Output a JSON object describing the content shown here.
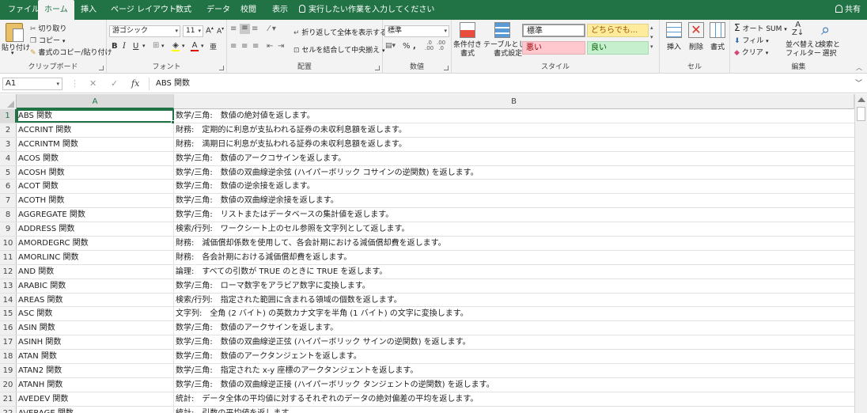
{
  "tabs": [
    "ファイル",
    "ホーム",
    "挿入",
    "ページ レイアウト",
    "数式",
    "データ",
    "校閲",
    "表示"
  ],
  "tell_me": "実行したい作業を入力してください",
  "share": "共有",
  "ribbon": {
    "clipboard": {
      "paste": "貼り付け",
      "cut": "切り取り",
      "copy": "コピー",
      "format_painter": "書式のコピー/貼り付け",
      "label": "クリップボード"
    },
    "font": {
      "name": "游ゴシック",
      "size": "11",
      "label": "フォント"
    },
    "alignment": {
      "wrap": "折り返して全体を表示する",
      "merge": "セルを結合して中央揃え",
      "label": "配置"
    },
    "number": {
      "format": "標準",
      "label": "数値"
    },
    "styles": {
      "conditional": "条件付き\n書式",
      "table": "テーブルとして\n書式設定",
      "normal": "標準",
      "neutral": "どちらでも...",
      "bad": "悪い",
      "good": "良い",
      "label": "スタイル"
    },
    "cells": {
      "insert": "挿入",
      "delete": "削除",
      "format": "書式",
      "label": "セル"
    },
    "editing": {
      "autosum": "オート SUM",
      "fill": "フィル",
      "clear": "クリア",
      "sort": "並べ替えと\nフィルター",
      "find": "検索と\n選択",
      "label": "編集"
    }
  },
  "formula_bar": {
    "name_box": "A1",
    "fx": "fx",
    "content": "ABS 関数"
  },
  "columns": [
    "A",
    "B"
  ],
  "rows": [
    {
      "n": "1",
      "a": "ABS 関数",
      "b": "数学/三角:　数値の絶対値を返します。"
    },
    {
      "n": "2",
      "a": "ACCRINT 関数",
      "b": "財務:　定期的に利息が支払われる証券の未収利息額を返します。"
    },
    {
      "n": "3",
      "a": "ACCRINTM 関数",
      "b": "財務:　満期日に利息が支払われる証券の未収利息額を返します。"
    },
    {
      "n": "4",
      "a": "ACOS 関数",
      "b": "数学/三角:　数値のアークコサインを返します。"
    },
    {
      "n": "5",
      "a": "ACOSH 関数",
      "b": "数学/三角:　数値の双曲線逆余弦 (ハイパーボリック コサインの逆関数) を返します。"
    },
    {
      "n": "6",
      "a": "ACOT 関数",
      "b": "数学/三角:　数値の逆余接を返します。"
    },
    {
      "n": "7",
      "a": "ACOTH 関数",
      "b": "数学/三角:　数値の双曲線逆余接を返します。"
    },
    {
      "n": "8",
      "a": "AGGREGATE 関数",
      "b": "数学/三角:　リストまたはデータベースの集計値を返します。"
    },
    {
      "n": "9",
      "a": "ADDRESS 関数",
      "b": "検索/行列:　ワークシート上のセル参照を文字列として返します。"
    },
    {
      "n": "10",
      "a": "AMORDEGRC 関数",
      "b": "財務:　減価償却係数を使用して、各会計期における減価償却費を返します。"
    },
    {
      "n": "11",
      "a": "AMORLINC 関数",
      "b": "財務:　各会計期における減価償却費を返します。"
    },
    {
      "n": "12",
      "a": "AND 関数",
      "b": "論理:　すべての引数が TRUE のときに TRUE を返します。"
    },
    {
      "n": "13",
      "a": "ARABIC 関数",
      "b": "数学/三角:　ローマ数字をアラビア数字に変換します。"
    },
    {
      "n": "14",
      "a": "AREAS 関数",
      "b": "検索/行列:　指定された範囲に含まれる領域の個数を返します。"
    },
    {
      "n": "15",
      "a": "ASC 関数",
      "b": "文字列:　全角 (2 バイト) の英数カナ文字を半角 (1 バイト) の文字に変換します。"
    },
    {
      "n": "16",
      "a": "ASIN 関数",
      "b": "数学/三角:　数値のアークサインを返します。"
    },
    {
      "n": "17",
      "a": "ASINH 関数",
      "b": "数学/三角:　数値の双曲線逆正弦 (ハイパーボリック サインの逆関数) を返します。"
    },
    {
      "n": "18",
      "a": "ATAN 関数",
      "b": "数学/三角:　数値のアークタンジェントを返します。"
    },
    {
      "n": "19",
      "a": "ATAN2 関数",
      "b": "数学/三角:　指定された x-y 座標のアークタンジェントを返します。"
    },
    {
      "n": "20",
      "a": "ATANH 関数",
      "b": "数学/三角:　数値の双曲線逆正接 (ハイパーボリック タンジェントの逆関数) を返します。"
    },
    {
      "n": "21",
      "a": "AVEDEV 関数",
      "b": "統計:　データ全体の平均値に対するそれぞれのデータの絶対偏差の平均を返します。"
    },
    {
      "n": "22",
      "a": "AVERAGE 関数",
      "b": "統計:　引数の平均値を返します。"
    }
  ],
  "colors": {
    "accent": "#217346"
  }
}
